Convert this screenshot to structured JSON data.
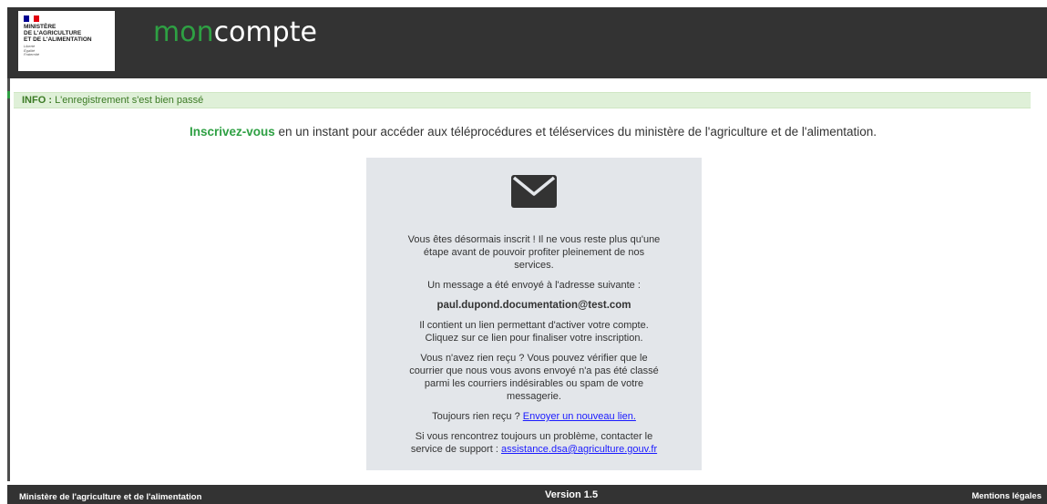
{
  "header": {
    "logo": {
      "lines": [
        "MINISTÈRE",
        "DE L'AGRICULTURE",
        "ET DE L'ALIMENTATION"
      ],
      "motto": [
        "Liberté",
        "Égalité",
        "Fraternité"
      ]
    },
    "brand_prefix": "mon",
    "brand_suffix": "compte"
  },
  "info": {
    "label": "INFO :",
    "message": "L'enregistrement s'est bien passé"
  },
  "intro": {
    "highlight": "Inscrivez-vous",
    "text": " en un instant pour accéder aux téléprocédures et téléservices du ministère de l'agriculture et de l'alimentation."
  },
  "card": {
    "icon": "envelope-icon",
    "p1": "Vous êtes désormais inscrit ! Il ne vous reste plus qu'une étape avant de pouvoir profiter pleinement de nos services.",
    "p2": "Un message a été envoyé à l'adresse suivante :",
    "email": "paul.dupond.documentation@test.com",
    "p3": "Il contient un lien permettant d'activer votre compte. Cliquez sur ce lien pour finaliser votre inscription.",
    "p4": "Vous n'avez rien reçu ? Vous pouvez vérifier que le courrier que nous vous avons envoyé n'a pas été classé parmi les courriers indésirables ou spam de votre messagerie.",
    "p5_text": "Toujours rien reçu ? ",
    "p5_link": "Envoyer un nouveau lien.",
    "p6_text": "Si vous rencontrez toujours un problème, contacter le service de support : ",
    "p6_link": "assistance.dsa@agriculture.gouv.fr"
  },
  "footer": {
    "left": "Ministère de l'agriculture et de l'alimentation",
    "center": "Version 1.5",
    "right": "Mentions légales"
  },
  "colors": {
    "header_bg": "#333333",
    "brand_green": "#2ea043",
    "info_bg": "#dff0d8",
    "info_text": "#3b7a24",
    "card_bg": "#e3e6ea",
    "link": "#1a1aff",
    "flag_blue": "#000091",
    "flag_red": "#e1000f"
  }
}
